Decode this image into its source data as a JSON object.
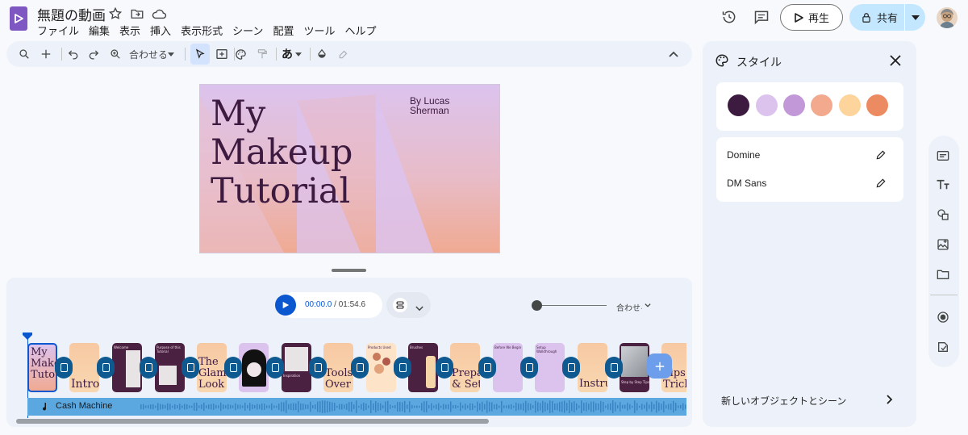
{
  "header": {
    "title": "無題の動画",
    "menu": [
      "ファイル",
      "編集",
      "表示",
      "挿入",
      "表示形式",
      "シーン",
      "配置",
      "ツール",
      "ヘルプ"
    ],
    "play_label": "再生",
    "share_label": "共有"
  },
  "toolbar": {
    "fit_label": "合わせる"
  },
  "slide": {
    "title_lines": [
      "My",
      "Makeup",
      "Tutorial"
    ],
    "author_lines": [
      "By Lucas",
      "Sherman"
    ]
  },
  "timeline": {
    "current_time": "00:00.0",
    "separator": " / ",
    "total_time": "01:54.6",
    "zoom_label": "合わせる",
    "audio_track": "Cash Machine",
    "scenes": [
      {
        "label": "My Makeup Tutorial",
        "text": "My\nMake\nTuto"
      },
      {
        "label": "Intro",
        "text": "Intro"
      },
      {
        "label": "Welcome",
        "text": "Welcome"
      },
      {
        "label": "Purpose of this Tutorial",
        "text": "Purpose of this Tutorial"
      },
      {
        "label": "The Glam Look",
        "text": "The\nGlam\nLook"
      },
      {
        "label": "Look",
        "text": ""
      },
      {
        "label": "Inspiration",
        "text": "Inspiration"
      },
      {
        "label": "Tools Overview",
        "text": "Tools\nOver"
      },
      {
        "label": "Products Used",
        "text": "Products Used"
      },
      {
        "label": "Brushes",
        "text": "Brushes"
      },
      {
        "label": "Preparation & Setup",
        "text": "Prepa\n& Set"
      },
      {
        "label": "Before We Begin",
        "text": "Before We Begin"
      },
      {
        "label": "Setup Walkthrough",
        "text": "Setup Walkthrough"
      },
      {
        "label": "Instructions",
        "text": "Instru"
      },
      {
        "label": "Step by Step Tips",
        "text": "Step by Step Tips"
      },
      {
        "label": "Tips & Tricks",
        "text": "Tips\nTrick"
      }
    ]
  },
  "style_panel": {
    "title": "スタイル",
    "swatches": [
      "#3d1a3f",
      "#dcc3ee",
      "#c398d8",
      "#f2a98e",
      "#fdd59c",
      "#ec8a61"
    ],
    "fonts": [
      "Domine",
      "DM Sans"
    ],
    "new_object_label": "新しいオブジェクトとシーン"
  },
  "colors": {
    "accent": "#0b57d0",
    "share_bg": "#c2e7ff",
    "transition": "#0e5a90",
    "audio_track": "#5ba7e0"
  },
  "icons": {
    "header": [
      "star-icon",
      "move-to-folder-icon",
      "cloud-status-icon",
      "history-icon",
      "comment-icon"
    ],
    "rail": [
      "layout-icon",
      "text-icon",
      "shapes-icon",
      "image-icon",
      "folder-icon",
      "record-icon",
      "import-icon"
    ]
  }
}
